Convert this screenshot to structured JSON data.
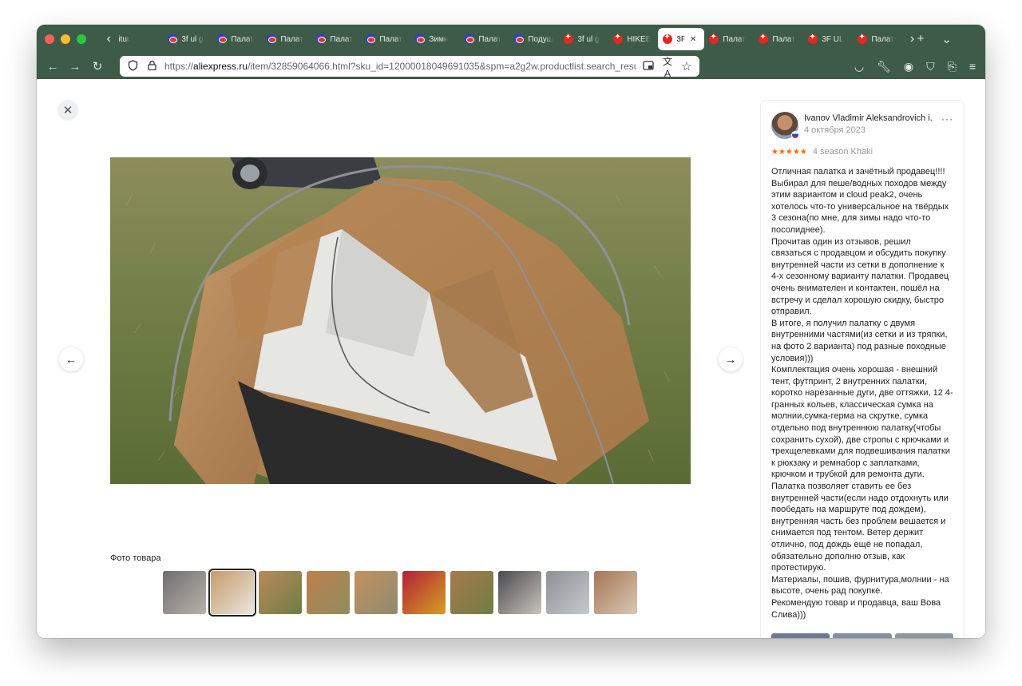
{
  "browser": {
    "tabs": [
      {
        "label": "itur",
        "favicon": "none"
      },
      {
        "label": "3f ul g",
        "favicon": "aliexpress-blue"
      },
      {
        "label": "Палат",
        "favicon": "aliexpress-blue"
      },
      {
        "label": "Палат",
        "favicon": "aliexpress-blue"
      },
      {
        "label": "Палат",
        "favicon": "aliexpress-blue"
      },
      {
        "label": "Палат",
        "favicon": "aliexpress-blue"
      },
      {
        "label": "Зимн",
        "favicon": "aliexpress-blue"
      },
      {
        "label": "Палат",
        "favicon": "aliexpress-blue"
      },
      {
        "label": "Подуш",
        "favicon": "aliexpress-blue"
      },
      {
        "label": "3f ul g",
        "favicon": "aliexpress-red"
      },
      {
        "label": "HIKEB",
        "favicon": "aliexpress-red"
      },
      {
        "label": "3F",
        "favicon": "aliexpress-red",
        "active": true
      },
      {
        "label": "Палат",
        "favicon": "aliexpress-red"
      },
      {
        "label": "Палат",
        "favicon": "aliexpress-red"
      },
      {
        "label": "3F UL",
        "favicon": "aliexpress-red"
      },
      {
        "label": "Палат",
        "favicon": "aliexpress-red"
      }
    ],
    "url_prefix": "https://",
    "url_domain": "aliexpress.ru",
    "url_rest": "/item/32859064066.html?sku_id=12000018049691035&spm=a2g2w.productlist.search_results"
  },
  "gallery": {
    "title": "Фото товара",
    "thumb_count": 10,
    "selected_index": 1
  },
  "review": {
    "author": "Ivanov Vladimir Aleksandrovich i.",
    "date": "4 октября 2023",
    "stars": "★★★★★",
    "rating": 5,
    "variant": "4 season Khaki",
    "text": "Отличная палатка и зачётный продавец!!!!\nВыбирал для пеше/водных походов между этим вариантом и cloud peak2, очень хотелось что-то универсальное на твёрдых 3 сезона(по мне, для зимы надо что-то посолиднее).\nПрочитав один из отзывов, решил связаться с продавцом и обсудить покупку внутренней части из сетки в дополнение к 4-х сезонному варианту палатки. Продавец очень внимателен и контактен, пошёл на встречу и сделал хорошую скидку, быстро отправил.\nВ итоге, я получил палатку с двумя внутренними частями(из сетки и из тряпки, на фото 2 варианта) под разные походные условия)))\nКомплектация очень хорошая - внешний тент, футпринт, 2 внутренних палатки, коротко нарезанные дуги, две оттяжки, 12 4-гранных кольев, классическая сумка на молнии,сумка-герма на скрутке, сумка отдельно под внутреннюю палатку(чтобы сохранить сухой), две стропы с крючками и трехщелевками для подвешивания палатки к рюкзаку и ремнабор с заплатками, крючком и трубкой для ремонта дуги. Палатка позволяет ставить ее без внутренней части(если надо отдохнуть или пообедать на маршруте под дождем), внутренняя часть без проблем вешается и снимается под тентом. Ветер держит отлично, под дождь ещё не попадал, обязательно дополню отзыв, как протестирую.\nМатериалы, пошив, фурнитура,молнии - на высоте, очень рад покупке.\nРекомендую товар и продавца, ваш Вова Слива)))"
  },
  "colors": {
    "browser_chrome": "#3e5a48",
    "star": "#ff6a00",
    "tent": "#b9895a"
  }
}
